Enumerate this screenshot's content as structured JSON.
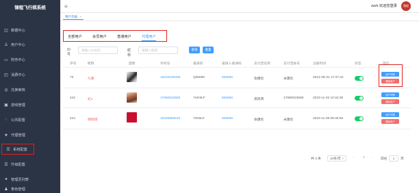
{
  "app": {
    "title": "锦程飞行棋系统"
  },
  "sidebar": {
    "items": [
      {
        "label": "数据中心",
        "icon": "data-icon"
      },
      {
        "label": "用户中心",
        "icon": "user-icon"
      },
      {
        "label": "财务中心",
        "icon": "finance-icon"
      },
      {
        "label": "消费中心",
        "icon": "consume-icon"
      },
      {
        "label": "兑换审核",
        "icon": "audit-icon"
      },
      {
        "label": "游戏管理",
        "icon": "game-icon"
      },
      {
        "label": "公共配置",
        "icon": "config-icon"
      },
      {
        "label": "代理管理",
        "icon": "star-icon"
      },
      {
        "label": "系统配置",
        "icon": "list-icon"
      },
      {
        "label": "升级配置",
        "icon": "upgrade-icon"
      },
      {
        "label": "管理员列表",
        "icon": "admin-icon"
      },
      {
        "label": "角色管理",
        "icon": "role-icon"
      },
      {
        "label": "菜单管理",
        "icon": "menu-icon"
      }
    ]
  },
  "header": {
    "user_label": "zwrk 欢迎您登录",
    "avatar_text": "锦程"
  },
  "tags": {
    "current": "用户列表",
    "close": "×"
  },
  "tabs": [
    "全部用户",
    "会员用户",
    "普通用户",
    "代理用户"
  ],
  "search": {
    "id_label": "ID号",
    "id_placeholder": "请输入ID号码",
    "nickname_label": "昵称",
    "nickname_placeholder": "请输入昵称",
    "search_button": "查询",
    "reset_button": "重置"
  },
  "table": {
    "columns": [
      "序号",
      "昵称",
      "图像",
      "手机号",
      "邀请码",
      "邀请人邀请码",
      "支付宝名称",
      "支付宝账号",
      "注册时间",
      "状态",
      "操作"
    ],
    "rows": [
      {
        "index": "73",
        "nickname": "九寨",
        "phone": "15033249259",
        "invite_code": "Q06090",
        "inviter_code": "606666",
        "alipay_name": "张康伦",
        "alipay_account": "米康伦",
        "reg_time": "2021-08-31 17:37:42",
        "status": true
      },
      {
        "index": "242",
        "nickname": "虹1",
        "phone": "17680523550",
        "invite_code": "7UK9LF",
        "inviter_code": "606666",
        "alipay_name": "高凤英",
        "alipay_account": "17680023559",
        "reg_time": "2023-11-02 10:34:30",
        "status": true
      },
      {
        "index": "244",
        "nickname": "锦程棋",
        "phone": "18326850510",
        "invite_code": "72K9LF",
        "inviter_code": "606666",
        "alipay_name": "张康伦",
        "alipay_account": "米康伦",
        "reg_time": "2023-11-06 09:35:55",
        "status": true
      }
    ],
    "actions": {
      "primary": "用户详情",
      "danger": "删除用户"
    }
  },
  "pagination": {
    "total_label": "共 3 条",
    "page_size": "10条/页",
    "page_size_arrow": "▾",
    "prev": "‹",
    "current_page": "1",
    "next": "›",
    "goto_label": "前往",
    "goto_value": "1",
    "page_suffix": "页"
  },
  "colors": {
    "sidebar_bg": "#2b3445",
    "primary": "#409eff",
    "danger": "#f56c6c",
    "switch_on": "#13ce66",
    "highlight": "#e02020"
  }
}
